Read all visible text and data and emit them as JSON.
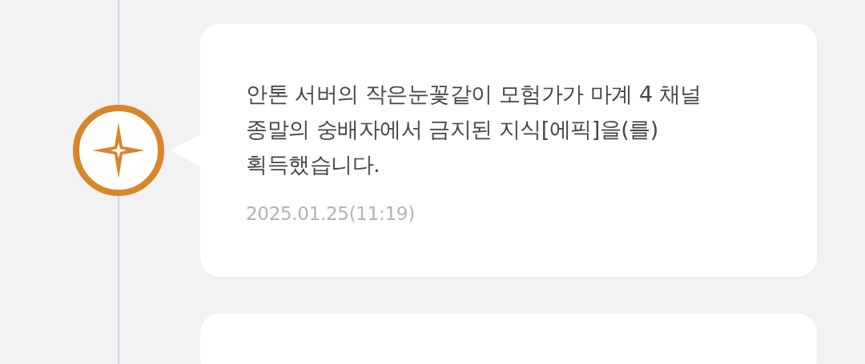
{
  "timeline": [
    {
      "message": "안톤 서버의 작은눈꽃같이 모험가가 마계 4 채널 종말의 숭배자에서 금지된 지식[에픽]을(를) 획득했습니다.",
      "time": "2025.01.25(11:19)"
    }
  ]
}
